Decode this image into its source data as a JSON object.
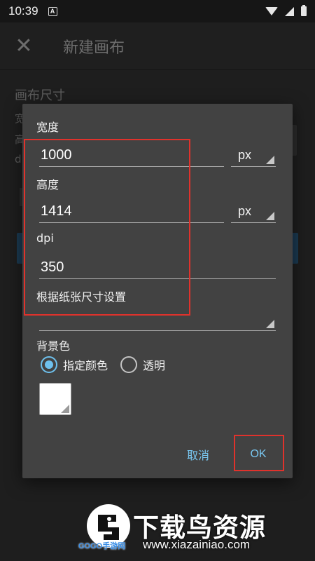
{
  "status_bar": {
    "time": "10:39",
    "notification_icon": "A",
    "icons": [
      "wifi-icon",
      "cell-signal-icon",
      "battery-icon"
    ]
  },
  "app_bar": {
    "close_icon": "close-icon",
    "title": "新建画布"
  },
  "background": {
    "section_title": "画布尺寸",
    "fragments": [
      "宽",
      "高",
      "d"
    ]
  },
  "dialog": {
    "width_label": "宽度",
    "width_value": "1000",
    "width_unit": "px",
    "height_label": "高度",
    "height_value": "1414",
    "height_unit": "px",
    "dpi_label": "dpi",
    "dpi_value": "350",
    "paper_label": "根据纸张尺寸设置",
    "paper_value": "",
    "background_color_label": "背景色",
    "radio_specified": "指定颜色",
    "radio_transparent": "透明",
    "selected_option": "指定颜色",
    "swatch_color": "#ffffff",
    "cancel_label": "取消",
    "ok_label": "OK"
  },
  "colors": {
    "dialog_bg": "#424242",
    "accent": "#79c8f2",
    "radio_checked": "#6ec1ee",
    "highlight_frame": "#e0322c"
  },
  "watermark": {
    "title": "下载鸟资源",
    "url": "www.xiazainiao.com",
    "small_logo": "GOGO手游网",
    "logo_icon": "bird-logo-icon"
  }
}
